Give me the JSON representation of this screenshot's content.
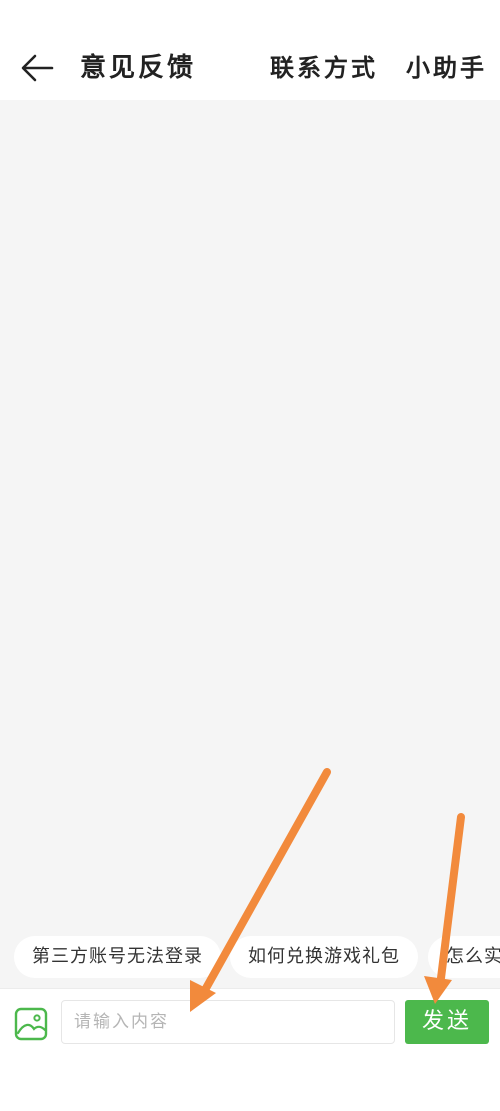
{
  "header": {
    "title": "意见反馈",
    "links": {
      "contact": "联系方式",
      "assistant": "小助手"
    }
  },
  "quick_questions": [
    "第三方账号无法登录",
    "如何兑换游戏礼包",
    "怎么实"
  ],
  "composer": {
    "placeholder": "请输入内容",
    "value": "",
    "send_label": "发送"
  },
  "colors": {
    "accent": "#4cb84c",
    "annotation_arrow": "#f28a3c",
    "chat_background": "#f5f5f5"
  },
  "icons": {
    "back": "arrow-left-icon",
    "image": "image-icon"
  }
}
